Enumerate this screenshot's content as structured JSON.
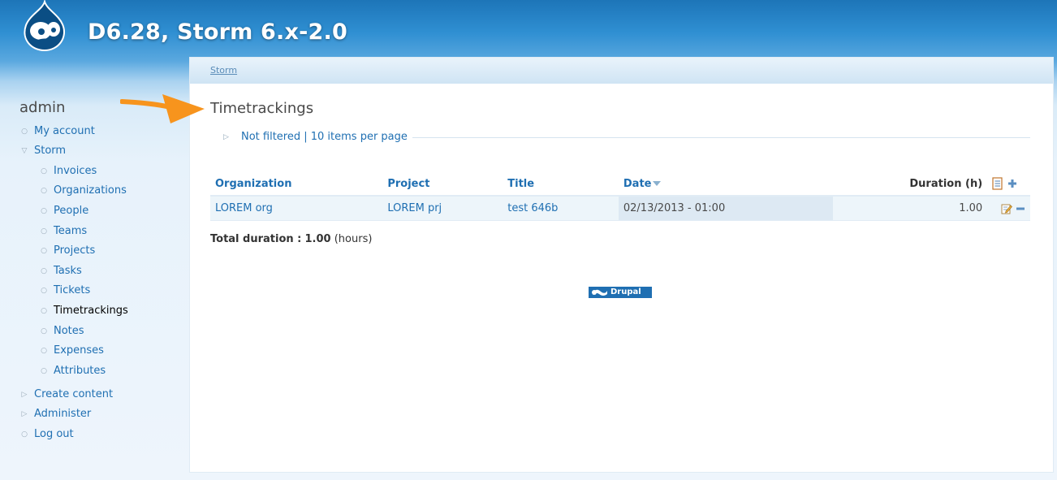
{
  "site": {
    "name": "D6.28, Storm 6.x-2.0"
  },
  "sidebar": {
    "title": "admin",
    "items": [
      {
        "label": "My account"
      },
      {
        "label": "Storm"
      },
      {
        "label": "Invoices"
      },
      {
        "label": "Organizations"
      },
      {
        "label": "People"
      },
      {
        "label": "Teams"
      },
      {
        "label": "Projects"
      },
      {
        "label": "Tasks"
      },
      {
        "label": "Tickets"
      },
      {
        "label": "Timetrackings"
      },
      {
        "label": "Notes"
      },
      {
        "label": "Expenses"
      },
      {
        "label": "Attributes"
      },
      {
        "label": "Create content"
      },
      {
        "label": "Administer"
      },
      {
        "label": "Log out"
      }
    ]
  },
  "breadcrumb": {
    "link": "Storm"
  },
  "page": {
    "title": "Timetrackings"
  },
  "filter": {
    "label": "Not filtered | 10 items per page"
  },
  "table": {
    "columns": {
      "organization": "Organization",
      "project": "Project",
      "title": "Title",
      "date": "Date",
      "duration": "Duration (h)"
    },
    "rows": [
      {
        "organization": "LOREM org",
        "project": "LOREM prj",
        "title": "test 646b",
        "date": "02/13/2013 - 01:00",
        "duration": "1.00"
      }
    ]
  },
  "total": {
    "label": "Total duration :",
    "value": "1.00",
    "unit": "(hours)"
  },
  "footer": {
    "badge": "Drupal"
  },
  "colors": {
    "link": "#1f6fb2",
    "header_blue": "#1d75b8",
    "annotation_arrow": "#f7941d"
  }
}
